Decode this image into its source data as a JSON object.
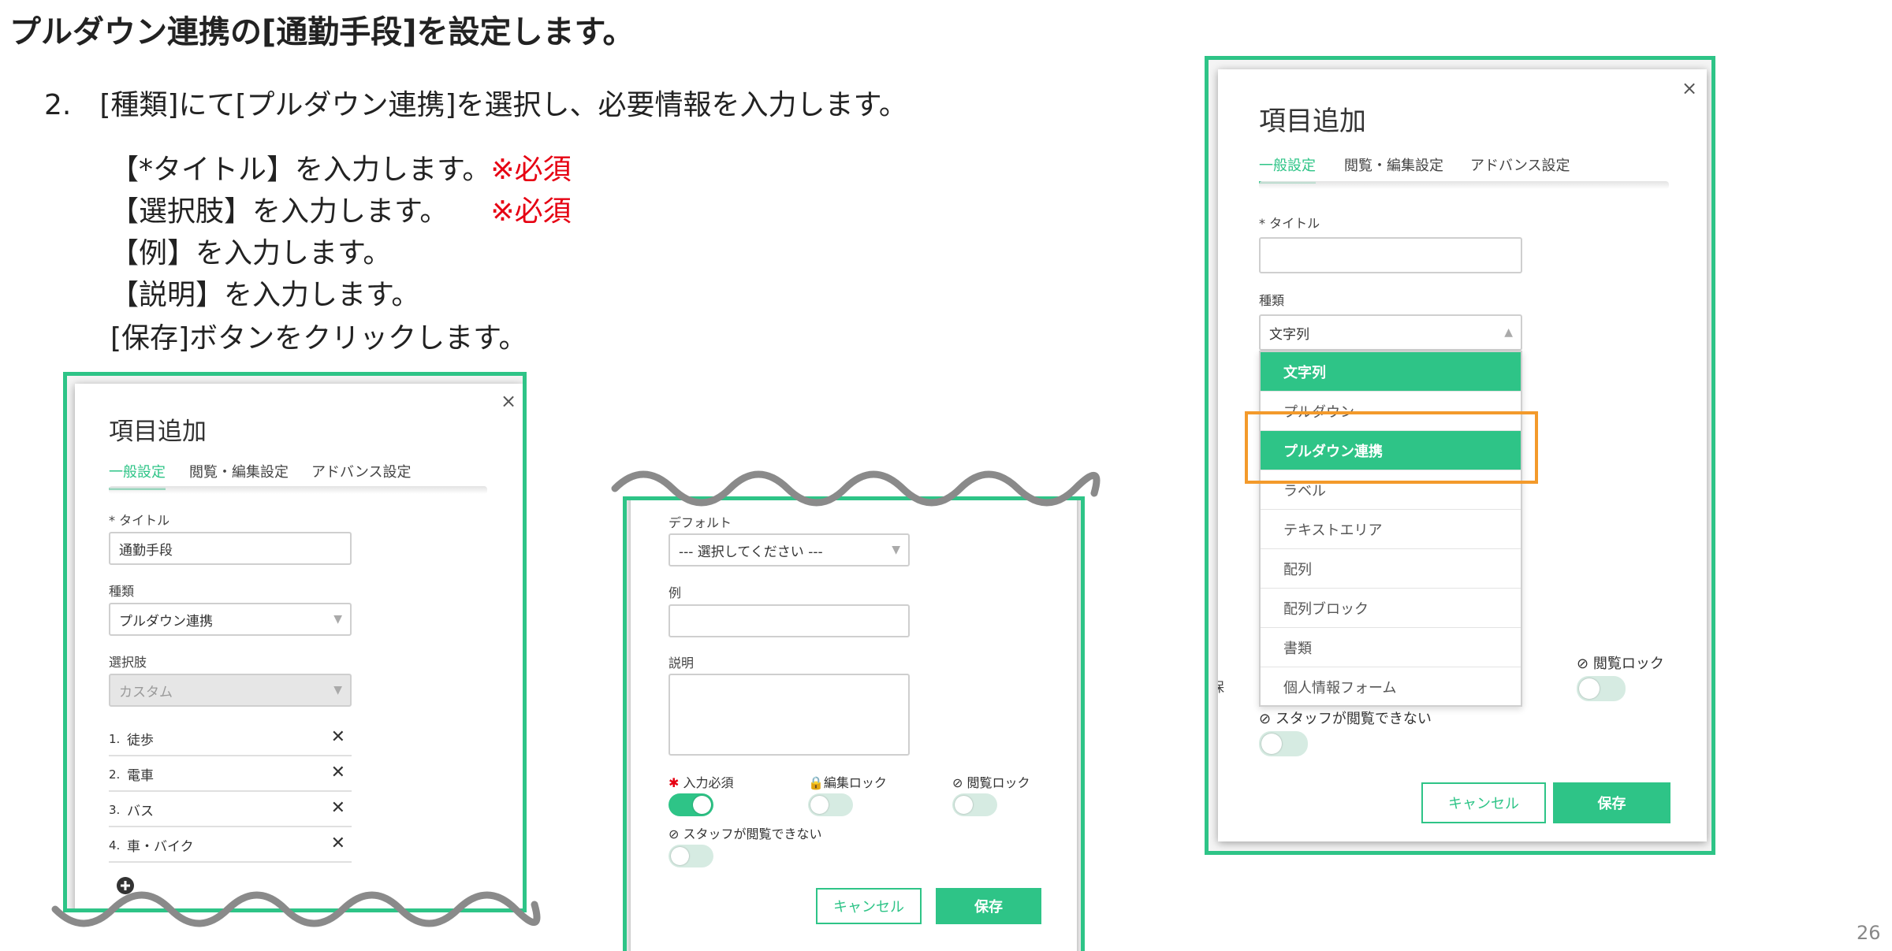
{
  "slide": {
    "title": "プルダウン連携の[通勤手段]を設定します。",
    "step": "2.　[種類]にて[プルダウン連携]を選択し、必要情報を入力します。",
    "instructions": [
      {
        "text": "【*タイトル】を入力します。",
        "req": "※必須"
      },
      {
        "text": "【選択肢】を入力します。　　",
        "req": "※必須"
      },
      {
        "text": "【例】を入力します。",
        "req": ""
      },
      {
        "text": "【説明】を入力します。",
        "req": ""
      },
      {
        "text": " [保存]ボタンをクリックします。",
        "req": ""
      }
    ],
    "page_number": "26"
  },
  "colors": {
    "accent": "#2ec487",
    "required": "#e60012",
    "highlight": "#f39a2b"
  },
  "dialog_left": {
    "title": "項目追加",
    "close": "×",
    "tabs": [
      "一般設定",
      "閲覧・編集設定",
      "アドバンス設定"
    ],
    "title_label": "* タイトル",
    "title_value": "通勤手段",
    "type_label": "種類",
    "type_value": "プルダウン連携",
    "choices_label": "選択肢",
    "choices_value": "カスタム",
    "choices": [
      {
        "num": "1.",
        "text": "徒歩"
      },
      {
        "num": "2.",
        "text": "電車"
      },
      {
        "num": "3.",
        "text": "バス"
      },
      {
        "num": "4.",
        "text": "車・バイク"
      }
    ],
    "add_icon": "plus-circle-icon"
  },
  "dialog_middle": {
    "default_label": "デフォルト",
    "default_value": "--- 選択してください ---",
    "example_label": "例",
    "description_label": "説明",
    "required_label": "入力必須",
    "edit_lock_label": "編集ロック",
    "view_lock_label": "閲覧ロック",
    "staff_hidden_label": "スタッフが閲覧できない",
    "required_on": 1,
    "cancel_label": "キャンセル",
    "save_label": "保存"
  },
  "dialog_right": {
    "title": "項目追加",
    "close": "×",
    "tabs": [
      "一般設定",
      "閲覧・編集設定",
      "アドバンス設定"
    ],
    "title_label": "* タイトル",
    "type_label": "種類",
    "type_value": "文字列",
    "options": [
      "文字列",
      "プルダウン",
      "プルダウン連携",
      "ラベル",
      "テキストエリア",
      "配列",
      "配列ブロック",
      "書類",
      "個人情報フォーム"
    ],
    "selected_index": 2,
    "side_letter": "保",
    "view_lock_label": "閲覧ロック",
    "staff_hidden_label": "スタッフが閲覧できない",
    "cancel_label": "キャンセル",
    "save_label": "保存"
  }
}
